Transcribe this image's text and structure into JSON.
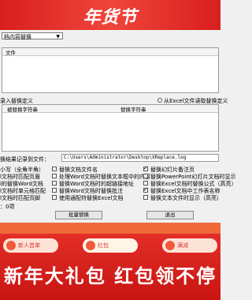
{
  "banner": {
    "title": "年货节"
  },
  "app": {
    "mode_select": "档内容替换",
    "file_list_header": "文件",
    "replace_def_label": "录入替换定义",
    "excel_option_label": "从Excel文件读取替换定义",
    "table_headers": [
      "被替换字符串",
      "替换字符串"
    ],
    "log_label": "换结果记录到文件：",
    "log_path": "C:\\Users\\Administrator\\Desktop\\XReplace.log",
    "options_col1": [
      "小写（全角半角）",
      "l文档时匹配页眉",
      "l的替换Word文档",
      "l文档时单元格匹配",
      "l文档时匹配页脚"
    ],
    "options_col2": [
      "替换文档文件名",
      "处理Word文档时替换文本框中的内容",
      "替换Word文档时的超链接地址",
      "替换Word文档时替换批注",
      "使用通配符替换Excel文档"
    ],
    "options_col3": [
      "替换幻灯片备注页",
      "替换PowerPoint幻灯片文档时显示",
      "替换Excel文档时替换公式（高亮）",
      "替换Excel文档中工作表名称",
      "替换文本文件时显示（高亮）"
    ],
    "status_text": "：0项",
    "buttons": {
      "batch": "批量替换",
      "exit": "退出"
    }
  },
  "bottom": {
    "pills": [
      "新人首单",
      "红包",
      "满减"
    ],
    "slogan": "新年大礼包 红包领不停"
  }
}
